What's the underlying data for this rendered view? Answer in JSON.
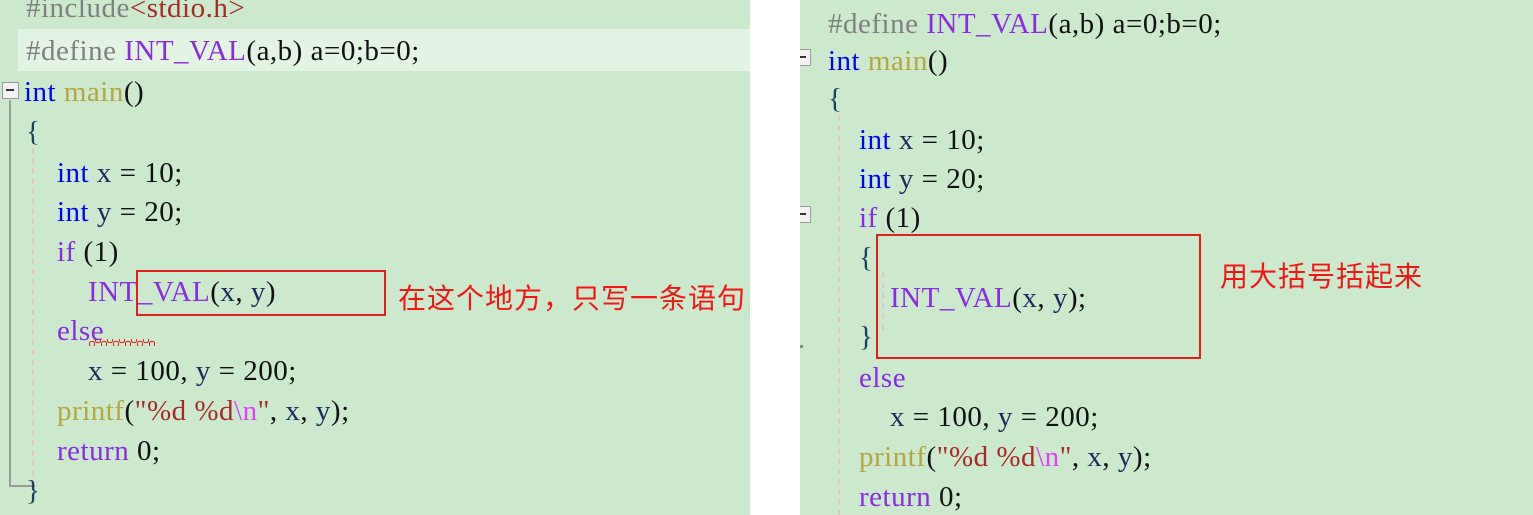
{
  "panels": {
    "left": {
      "name": "before-fix-code-panel",
      "background_color": "#cce9ce",
      "highlight_color": "#e3f3e4",
      "lines": [
        {
          "id": "l0",
          "text": "#include<stdio.h>",
          "clipped_top": true
        },
        {
          "id": "l1",
          "text": "#define INT_VAL(a,b) a=0;b=0;",
          "highlighted": true
        },
        {
          "id": "l2",
          "text": "int main()"
        },
        {
          "id": "l3",
          "text": "{"
        },
        {
          "id": "l4",
          "text": "    int x = 10;"
        },
        {
          "id": "l5",
          "text": "    int y = 20;"
        },
        {
          "id": "l6",
          "text": "    if (1)"
        },
        {
          "id": "l7",
          "text": "        INT_VAL(x, y)"
        },
        {
          "id": "l8",
          "text": "    else",
          "error_squiggle": true
        },
        {
          "id": "l9",
          "text": "        x = 100, y = 200;"
        },
        {
          "id": "l10",
          "text": "    printf(\"%d %d\\n\", x, y);"
        },
        {
          "id": "l11",
          "text": "    return 0;"
        },
        {
          "id": "l12",
          "text": "}"
        }
      ],
      "annotation": {
        "box_target": "INT_VAL(x, y)",
        "text": "在这个地方，只写一条语句",
        "color": "#f21616"
      }
    },
    "right": {
      "name": "after-fix-code-panel",
      "background_color": "#cce9ce",
      "lines": [
        {
          "id": "r1",
          "text": "#define INT_VAL(a,b) a=0;b=0;"
        },
        {
          "id": "r2",
          "text": "int main()"
        },
        {
          "id": "r3",
          "text": "{"
        },
        {
          "id": "r4",
          "text": "    int x = 10;"
        },
        {
          "id": "r5",
          "text": "    int y = 20;"
        },
        {
          "id": "r6",
          "text": "    if (1)"
        },
        {
          "id": "r7",
          "text": "    {"
        },
        {
          "id": "r8",
          "text": "        INT_VAL(x, y);"
        },
        {
          "id": "r9",
          "text": "    }"
        },
        {
          "id": "r10",
          "text": "    else"
        },
        {
          "id": "r11",
          "text": "        x = 100, y = 200;"
        },
        {
          "id": "r12",
          "text": "    printf(\"%d %d\\n\", x, y);"
        },
        {
          "id": "r13",
          "text": "    return 0;"
        }
      ],
      "annotation": {
        "box_target": "{ INT_VAL(x, y); }",
        "text": "用大括号括起来",
        "color": "#f21616"
      }
    }
  },
  "tokens": {
    "include_directive": "#include",
    "include_header": "<stdio.h>",
    "define_directive": "#define",
    "macro_name": "INT_VAL",
    "macro_params": "(a,b)",
    "macro_body": " a=0;b=0;",
    "kw_int": "int",
    "fn_main": "main",
    "fn_printf": "printf",
    "kw_if": "if",
    "kw_else": "else",
    "kw_return": "return",
    "var_x": "x",
    "var_y": "y",
    "num_10": "10",
    "num_20": "20",
    "num_100": "100",
    "num_200": "200",
    "num_0": "0",
    "num_1": "1",
    "fmt_string": "\"%d %d",
    "escape_n": "\\n",
    "quote_close": "\"",
    "brace_open": "{",
    "brace_close": "}",
    "paren_open": "(",
    "paren_close": ")",
    "semicolon": ";",
    "comma": ",",
    "equals": "="
  },
  "colors": {
    "editor_bg": "#cce9ce",
    "current_line_bg": "#e3f3e4",
    "preprocessor": "#808080",
    "macro": "#8a2be2",
    "keyword_type": "#0000ff",
    "keyword_flow": "#8a2be2",
    "function": "#b5a642",
    "identifier": "#1b2a5e",
    "string": "#a52a2a",
    "escape": "#e040fb",
    "annotation_red": "#f21616",
    "error_squiggle": "#e50000",
    "gutter_line": "#9b9b9b",
    "indent_guide": "#dcc9cf"
  },
  "gutter": {
    "fold_marker_glyph": "minus-box",
    "fold_marker_count_left": 1,
    "fold_marker_count_right": 2
  }
}
